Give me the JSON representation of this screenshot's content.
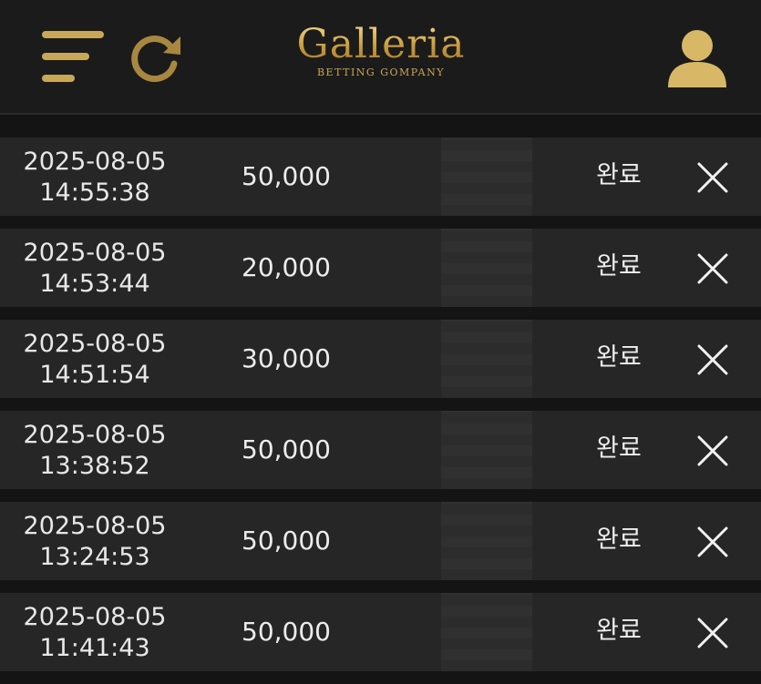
{
  "header": {
    "logo_title": "Galleria",
    "logo_subtitle": "BETTING GOMPANY",
    "menu_icon": "hamburger-menu-icon",
    "refresh_icon": "refresh-icon",
    "user_icon": "user-icon",
    "accent_color": "#c9a75a"
  },
  "rows": [
    {
      "date": "2025-08-05",
      "time": "14:55:38",
      "amount": "50,000",
      "status": "완료"
    },
    {
      "date": "2025-08-05",
      "time": "14:53:44",
      "amount": "20,000",
      "status": "완료"
    },
    {
      "date": "2025-08-05",
      "time": "14:51:54",
      "amount": "30,000",
      "status": "완료"
    },
    {
      "date": "2025-08-05",
      "time": "13:38:52",
      "amount": "50,000",
      "status": "완료"
    },
    {
      "date": "2025-08-05",
      "time": "13:24:53",
      "amount": "50,000",
      "status": "완료"
    },
    {
      "date": "2025-08-05",
      "time": "11:41:43",
      "amount": "50,000",
      "status": "완료"
    }
  ]
}
